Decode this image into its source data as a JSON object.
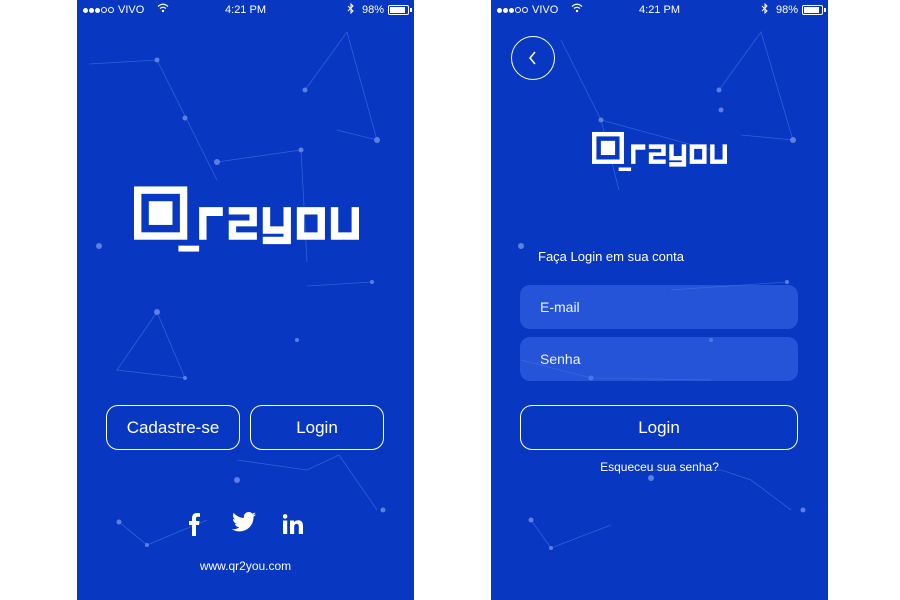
{
  "colors": {
    "brand_blue": "#0837c1",
    "white": "#ffffff",
    "field_bg": "#3f6eea",
    "network_line": "#5d7fe0"
  },
  "status_bar": {
    "carrier": "VIVO",
    "time": "4:21 PM",
    "battery": "98%",
    "signal_bars": 5,
    "signal_filled": 3,
    "battery_level": 0.98
  },
  "welcome": {
    "logo_text": "qr2you",
    "buttons": {
      "signup": "Cadastre-se",
      "login": "Login"
    },
    "social_icons": [
      "facebook-icon",
      "twitter-icon",
      "linkedin-icon"
    ],
    "website": "www.qr2you.com"
  },
  "login": {
    "back_icon": "chevron-left-icon",
    "logo_text": "qr2you",
    "prompt": "Faça Login em sua conta",
    "email_placeholder": "E-mail",
    "password_placeholder": "Senha",
    "login_button": "Login",
    "forgot_password": "Esqueceu sua senha?"
  }
}
